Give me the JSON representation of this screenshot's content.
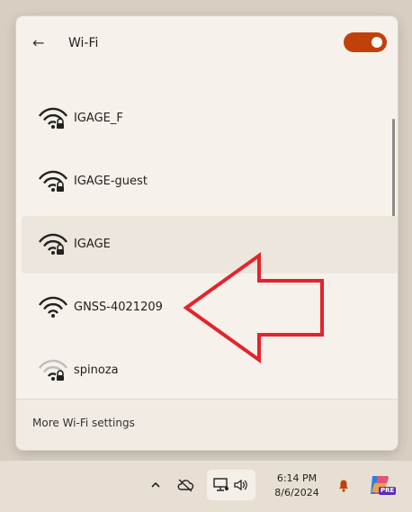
{
  "header": {
    "back_icon": "←",
    "title": "Wi-Fi",
    "toggle_on": true,
    "accent": "#c0420a"
  },
  "networks": [
    {
      "name": "IGAGE_F",
      "secured": true,
      "signal": 4
    },
    {
      "name": "IGAGE-guest",
      "secured": true,
      "signal": 4
    },
    {
      "name": "IGAGE",
      "secured": true,
      "signal": 4,
      "selected": true
    },
    {
      "name": "GNSS-4021209",
      "secured": false,
      "signal": 4
    },
    {
      "name": "spinoza",
      "secured": true,
      "signal": 2
    }
  ],
  "footer": {
    "more_label": "More Wi-Fi settings"
  },
  "taskbar": {
    "time": "6:14 PM",
    "date": "8/6/2024",
    "badge": "PRE"
  },
  "annotation_color": "#e3242b"
}
